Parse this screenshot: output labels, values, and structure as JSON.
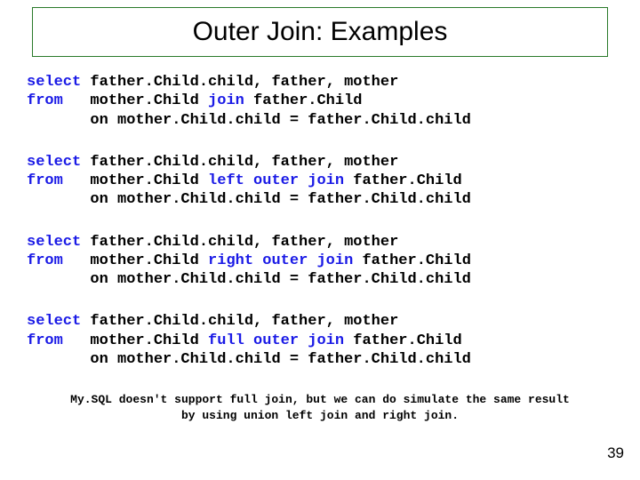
{
  "title": "Outer Join: Examples",
  "blocks": [
    {
      "l1a": "select",
      "l1b": " father.Child.child, father, mother",
      "l2a": "from",
      "l2b": "   mother.Child ",
      "l2kw": "join",
      "l2c": " father.Child",
      "l3": "       on mother.Child.child = father.Child.child"
    },
    {
      "l1a": "select",
      "l1b": " father.Child.child, father, mother",
      "l2a": "from",
      "l2b": "   mother.Child ",
      "l2kw": "left outer join",
      "l2c": " father.Child",
      "l3": "       on mother.Child.child = father.Child.child"
    },
    {
      "l1a": "select",
      "l1b": " father.Child.child, father, mother",
      "l2a": "from",
      "l2b": "   mother.Child ",
      "l2kw": "right outer join",
      "l2c": " father.Child",
      "l3": "       on mother.Child.child = father.Child.child"
    },
    {
      "l1a": "select",
      "l1b": " father.Child.child, father, mother",
      "l2a": "from",
      "l2b": "   mother.Child ",
      "l2kw": "full outer join",
      "l2c": " father.Child",
      "l3": "       on mother.Child.child = father.Child.child"
    }
  ],
  "footnote": "My.SQL doesn't support full join, but we can do simulate the same result by using union left join and right join.",
  "page_number": "39"
}
